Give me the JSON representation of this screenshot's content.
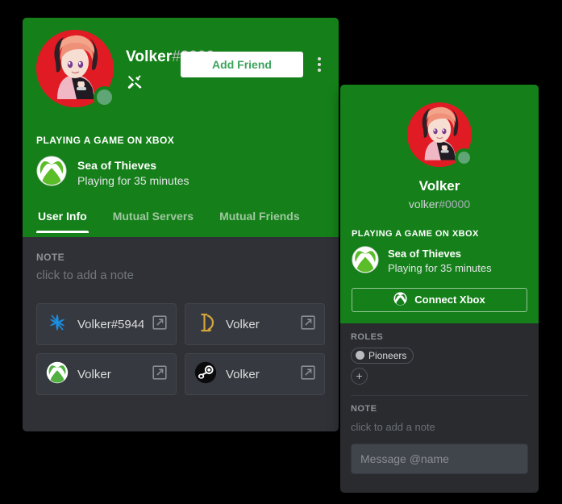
{
  "profile_modal": {
    "username": "Volker",
    "discriminator": "#0000",
    "badges": [
      {
        "name": "discord-developer-badge"
      }
    ],
    "add_friend_label": "Add Friend",
    "more_options_label": "More",
    "activity": {
      "header": "PLAYING A GAME ON XBOX",
      "game_name": "Sea of Thieves",
      "game_time": "Playing for 35 minutes",
      "icon": "xbox-icon"
    },
    "tabs": [
      {
        "label": "User Info",
        "active": true
      },
      {
        "label": "Mutual Servers",
        "active": false
      },
      {
        "label": "Mutual Friends",
        "active": false
      }
    ],
    "note": {
      "label": "NOTE",
      "placeholder": "click to add a note"
    },
    "connections": [
      {
        "service": "battlenet",
        "name": "Volker#5944"
      },
      {
        "service": "leagueoflegends",
        "name": "Volker"
      },
      {
        "service": "xbox",
        "name": "Volker"
      },
      {
        "service": "steam",
        "name": "Volker"
      }
    ]
  },
  "popout": {
    "username": "Volker",
    "tag_name": "volker",
    "tag_discriminator": "#0000",
    "activity": {
      "header": "PLAYING A GAME ON XBOX",
      "game_name": "Sea of Thieves",
      "game_time": "Playing for 35 minutes",
      "connect_label": "Connect Xbox"
    },
    "roles": {
      "label": "ROLES",
      "items": [
        {
          "name": "Pioneers",
          "color": "#b9bbbe"
        }
      ],
      "add_label": "+"
    },
    "note": {
      "label": "NOTE",
      "placeholder": "click to add a note"
    },
    "message": {
      "placeholder": "Message @name",
      "value": ""
    }
  },
  "colors": {
    "banner_green": "#15801a",
    "modal_bg": "#2f3136",
    "popout_bg": "#292b2f",
    "card_bg": "#36393f",
    "accent_white": "#ffffff",
    "status_online": "#5fa575",
    "add_friend_text": "#3ba55c"
  }
}
